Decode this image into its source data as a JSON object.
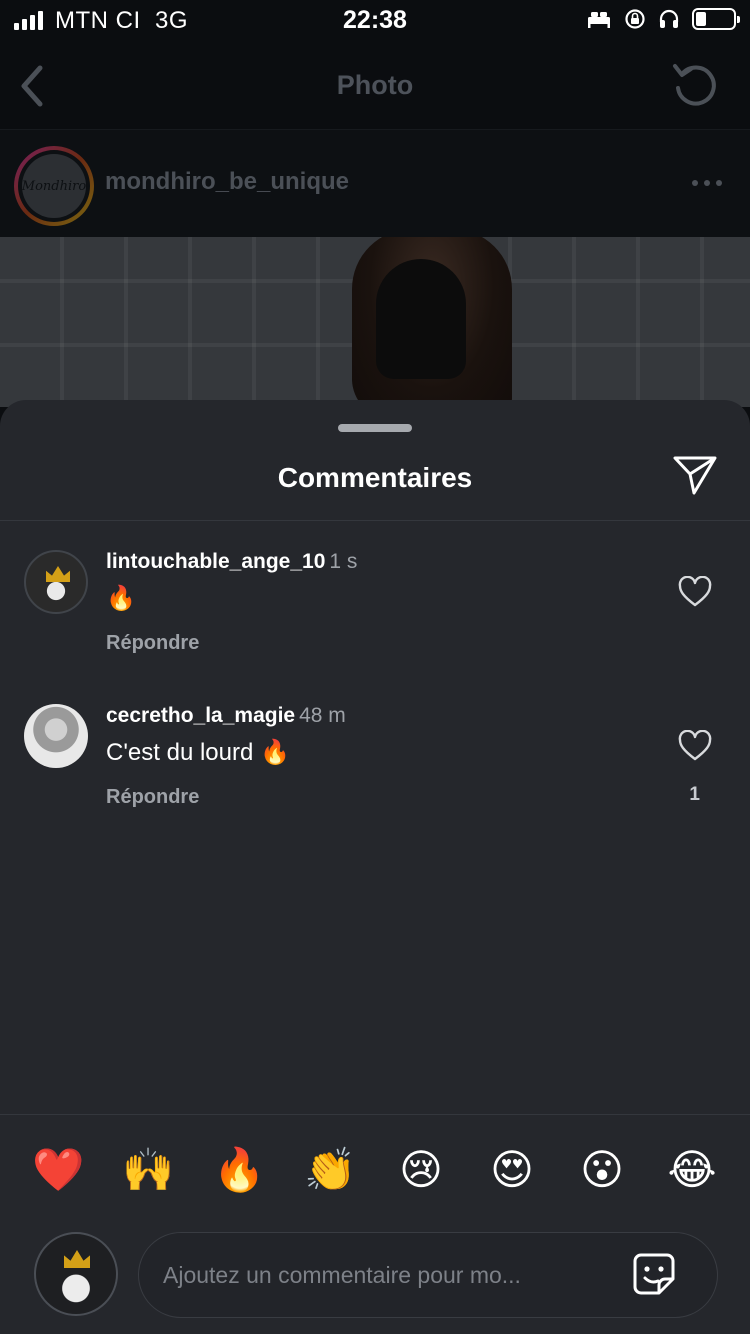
{
  "status_bar": {
    "carrier": "MTN CI",
    "network": "3G",
    "time": "22:38"
  },
  "topbar": {
    "title": "Photo",
    "back_icon": "chevron-left-icon",
    "reload_icon": "reload-icon"
  },
  "post": {
    "account": "mondhiro_be_unique",
    "avatar_text": "Mondhiro"
  },
  "sheet": {
    "title": "Commentaires",
    "send_icon": "paper-plane-icon",
    "comments": [
      {
        "user": "lintouchable_ange_10",
        "time": "1 s",
        "text": "🔥",
        "reply": "Répondre",
        "likes": ""
      },
      {
        "user": "cecretho_la_magie",
        "time": "48 m",
        "text": "C'est du lourd 🔥",
        "reply": "Répondre",
        "likes": "1"
      }
    ],
    "emoji_reactions": [
      "❤️",
      "🙌",
      "🔥",
      "👏",
      "😢",
      "😍",
      "😮",
      "😂"
    ]
  },
  "composer": {
    "placeholder": "Ajoutez un commentaire pour mo..."
  },
  "colors": {
    "sheet_bg": "#25272c",
    "page_bg": "#0b0d10",
    "muted_text": "#9ea2a8"
  }
}
